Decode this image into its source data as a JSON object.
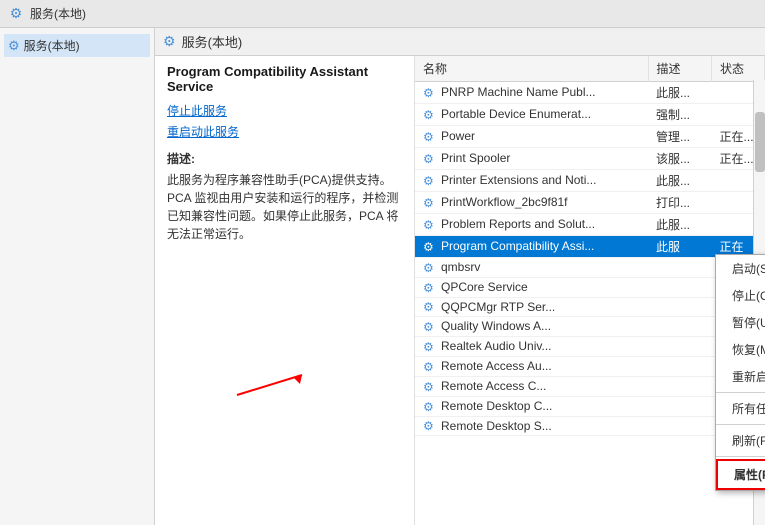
{
  "titleBar": {
    "icon": "⚙",
    "text": "服务(本地)"
  },
  "contentHeader": {
    "icon": "⚙",
    "text": "服务(本地)"
  },
  "sidebar": {
    "items": [
      {
        "label": "服务(本地)",
        "selected": true
      }
    ]
  },
  "leftPanel": {
    "serviceTitle": "Program Compatibility Assistant Service",
    "stopLink": "停止此服务",
    "restartLink": "重启动此服务",
    "descTitle": "描述:",
    "descText": "此服务为程序兼容性助手(PCA)提供支持。PCA 监视由用户安装和运行的程序，并检测已知兼容性问题。如果停止此服务，PCA 将无法正常运行。"
  },
  "table": {
    "columns": [
      "名称",
      "描述",
      "状态"
    ],
    "rows": [
      {
        "name": "PNRP Machine Name Publ...",
        "desc": "此服...",
        "status": ""
      },
      {
        "name": "Portable Device Enumerat...",
        "desc": "强制...",
        "status": ""
      },
      {
        "name": "Power",
        "desc": "管理...",
        "status": "正在..."
      },
      {
        "name": "Print Spooler",
        "desc": "该服...",
        "status": "正在..."
      },
      {
        "name": "Printer Extensions and Noti...",
        "desc": "此服...",
        "status": ""
      },
      {
        "name": "PrintWorkflow_2bc9f81f",
        "desc": "打印...",
        "status": ""
      },
      {
        "name": "Problem Reports and Solut...",
        "desc": "此服...",
        "status": ""
      },
      {
        "name": "Program Compatibility Assi...",
        "desc": "此服",
        "status": "正在",
        "selected": true
      },
      {
        "name": "qmbsrv",
        "desc": "",
        "status": ""
      },
      {
        "name": "QPCore Service",
        "desc": "",
        "status": ""
      },
      {
        "name": "QQPCMgr RTP Ser...",
        "desc": "",
        "status": ""
      },
      {
        "name": "Quality Windows A...",
        "desc": "",
        "status": ""
      },
      {
        "name": "Realtek Audio Univ...",
        "desc": "",
        "status": ""
      },
      {
        "name": "Remote Access Au...",
        "desc": "",
        "status": ""
      },
      {
        "name": "Remote Access C...",
        "desc": "",
        "status": ""
      },
      {
        "name": "Remote Desktop C...",
        "desc": "",
        "status": ""
      },
      {
        "name": "Remote Desktop S...",
        "desc": "",
        "status": ""
      }
    ]
  },
  "contextMenu": {
    "items": [
      {
        "label": "启动(S)",
        "key": "start"
      },
      {
        "label": "停止(O)",
        "key": "stop"
      },
      {
        "label": "暂停(U)",
        "key": "pause"
      },
      {
        "label": "恢复(M)",
        "key": "resume"
      },
      {
        "label": "重新启动(E)",
        "key": "restart"
      },
      {
        "separator": true
      },
      {
        "label": "所有任务(K)",
        "key": "all-tasks",
        "hasArrow": true
      },
      {
        "separator": true
      },
      {
        "label": "刷新(F)",
        "key": "refresh"
      },
      {
        "separator": true
      },
      {
        "label": "属性(R)",
        "key": "properties",
        "highlighted": true
      }
    ]
  }
}
